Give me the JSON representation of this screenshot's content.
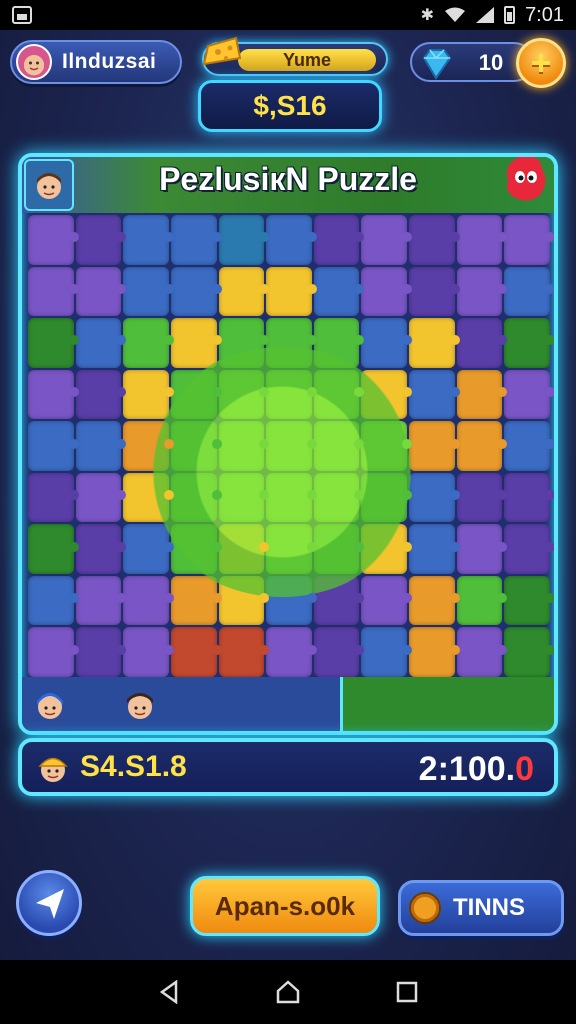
{
  "status_bar": {
    "time": "7:01",
    "icons": [
      "bluetooth-icon",
      "wifi-icon",
      "signal-icon",
      "battery-icon"
    ]
  },
  "hud": {
    "player_name": "Ilnduzsai",
    "mode_label": "Yume",
    "money": "$,S16",
    "gem_count": "10",
    "plus_symbol": "+"
  },
  "board": {
    "title": "PezlusiкN Puzzle",
    "colors": {
      "frame": "#5fe8ff",
      "water": "#3b6bc2",
      "land": "#4fbe3a",
      "sand": "#f2c42e"
    }
  },
  "score_bar": {
    "left_value": "S4.S1.8",
    "right_value_main": "2:100.",
    "right_value_accent": "0"
  },
  "buttons": {
    "action_label": "Apan-s.o0k",
    "tips_label": "TINNS"
  },
  "nav": {
    "icons": [
      "back-icon",
      "home-icon",
      "recents-icon"
    ]
  }
}
